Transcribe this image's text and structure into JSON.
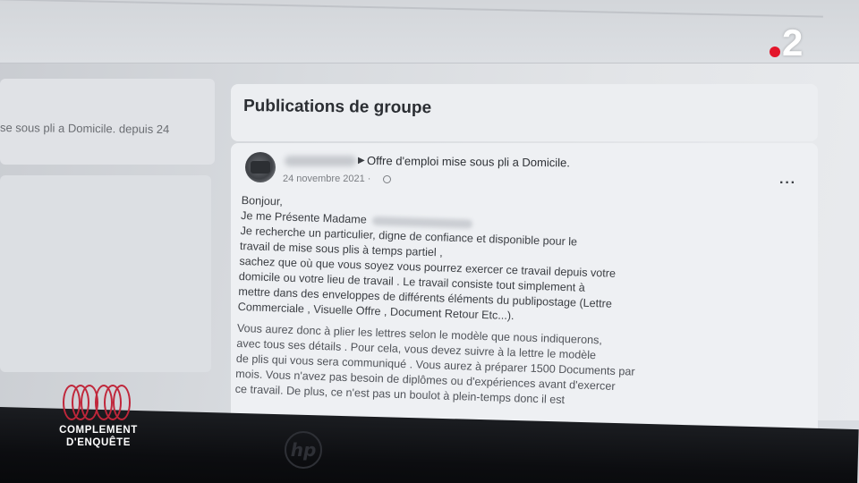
{
  "left_column": {
    "snippet": "se sous pli a Domicile. depuis 24"
  },
  "group_feed": {
    "header_title": "Publications de groupe"
  },
  "post": {
    "group_name": "Offre d'emploi mise sous pli a Domicile.",
    "date": "24 novembre 2021 ·",
    "more_label": "···",
    "lines": [
      "Bonjour,",
      "Je me Présente Madame",
      "Je recherche un particulier, digne de confiance et disponible pour le",
      "travail de mise sous plis à temps partiel ,",
      "sachez que où que vous soyez vous pourrez exercer ce travail depuis votre",
      "domicile ou votre lieu de travail . Le travail consiste tout simplement à",
      "mettre dans des enveloppes de différents éléments du publipostage (Lettre",
      "Commerciale , Visuelle Offre , Document Retour Etc...).",
      "Vous aurez donc à plier les lettres selon le modèle que nous indiquerons,",
      "avec tous ses détails . Pour cela, vous devez suivre à la lettre le modèle",
      "de plis qui vous sera communiqué . Vous aurez à préparer 1500 Documents par",
      "mois. Vous n'avez pas besoin de diplômes ou d'expériences avant d'exercer",
      "ce travail. De plus, ce n'est pas un boulot à plein-temps donc il est"
    ]
  },
  "overlay": {
    "channel_number": "2",
    "show_title_line1": "COMPLEMENT",
    "show_title_line2": "D'ENQUÊTE",
    "brand_mark": "hp"
  },
  "colors": {
    "channel_dot": "#e3152a",
    "show_stripes": "#c0263a"
  }
}
